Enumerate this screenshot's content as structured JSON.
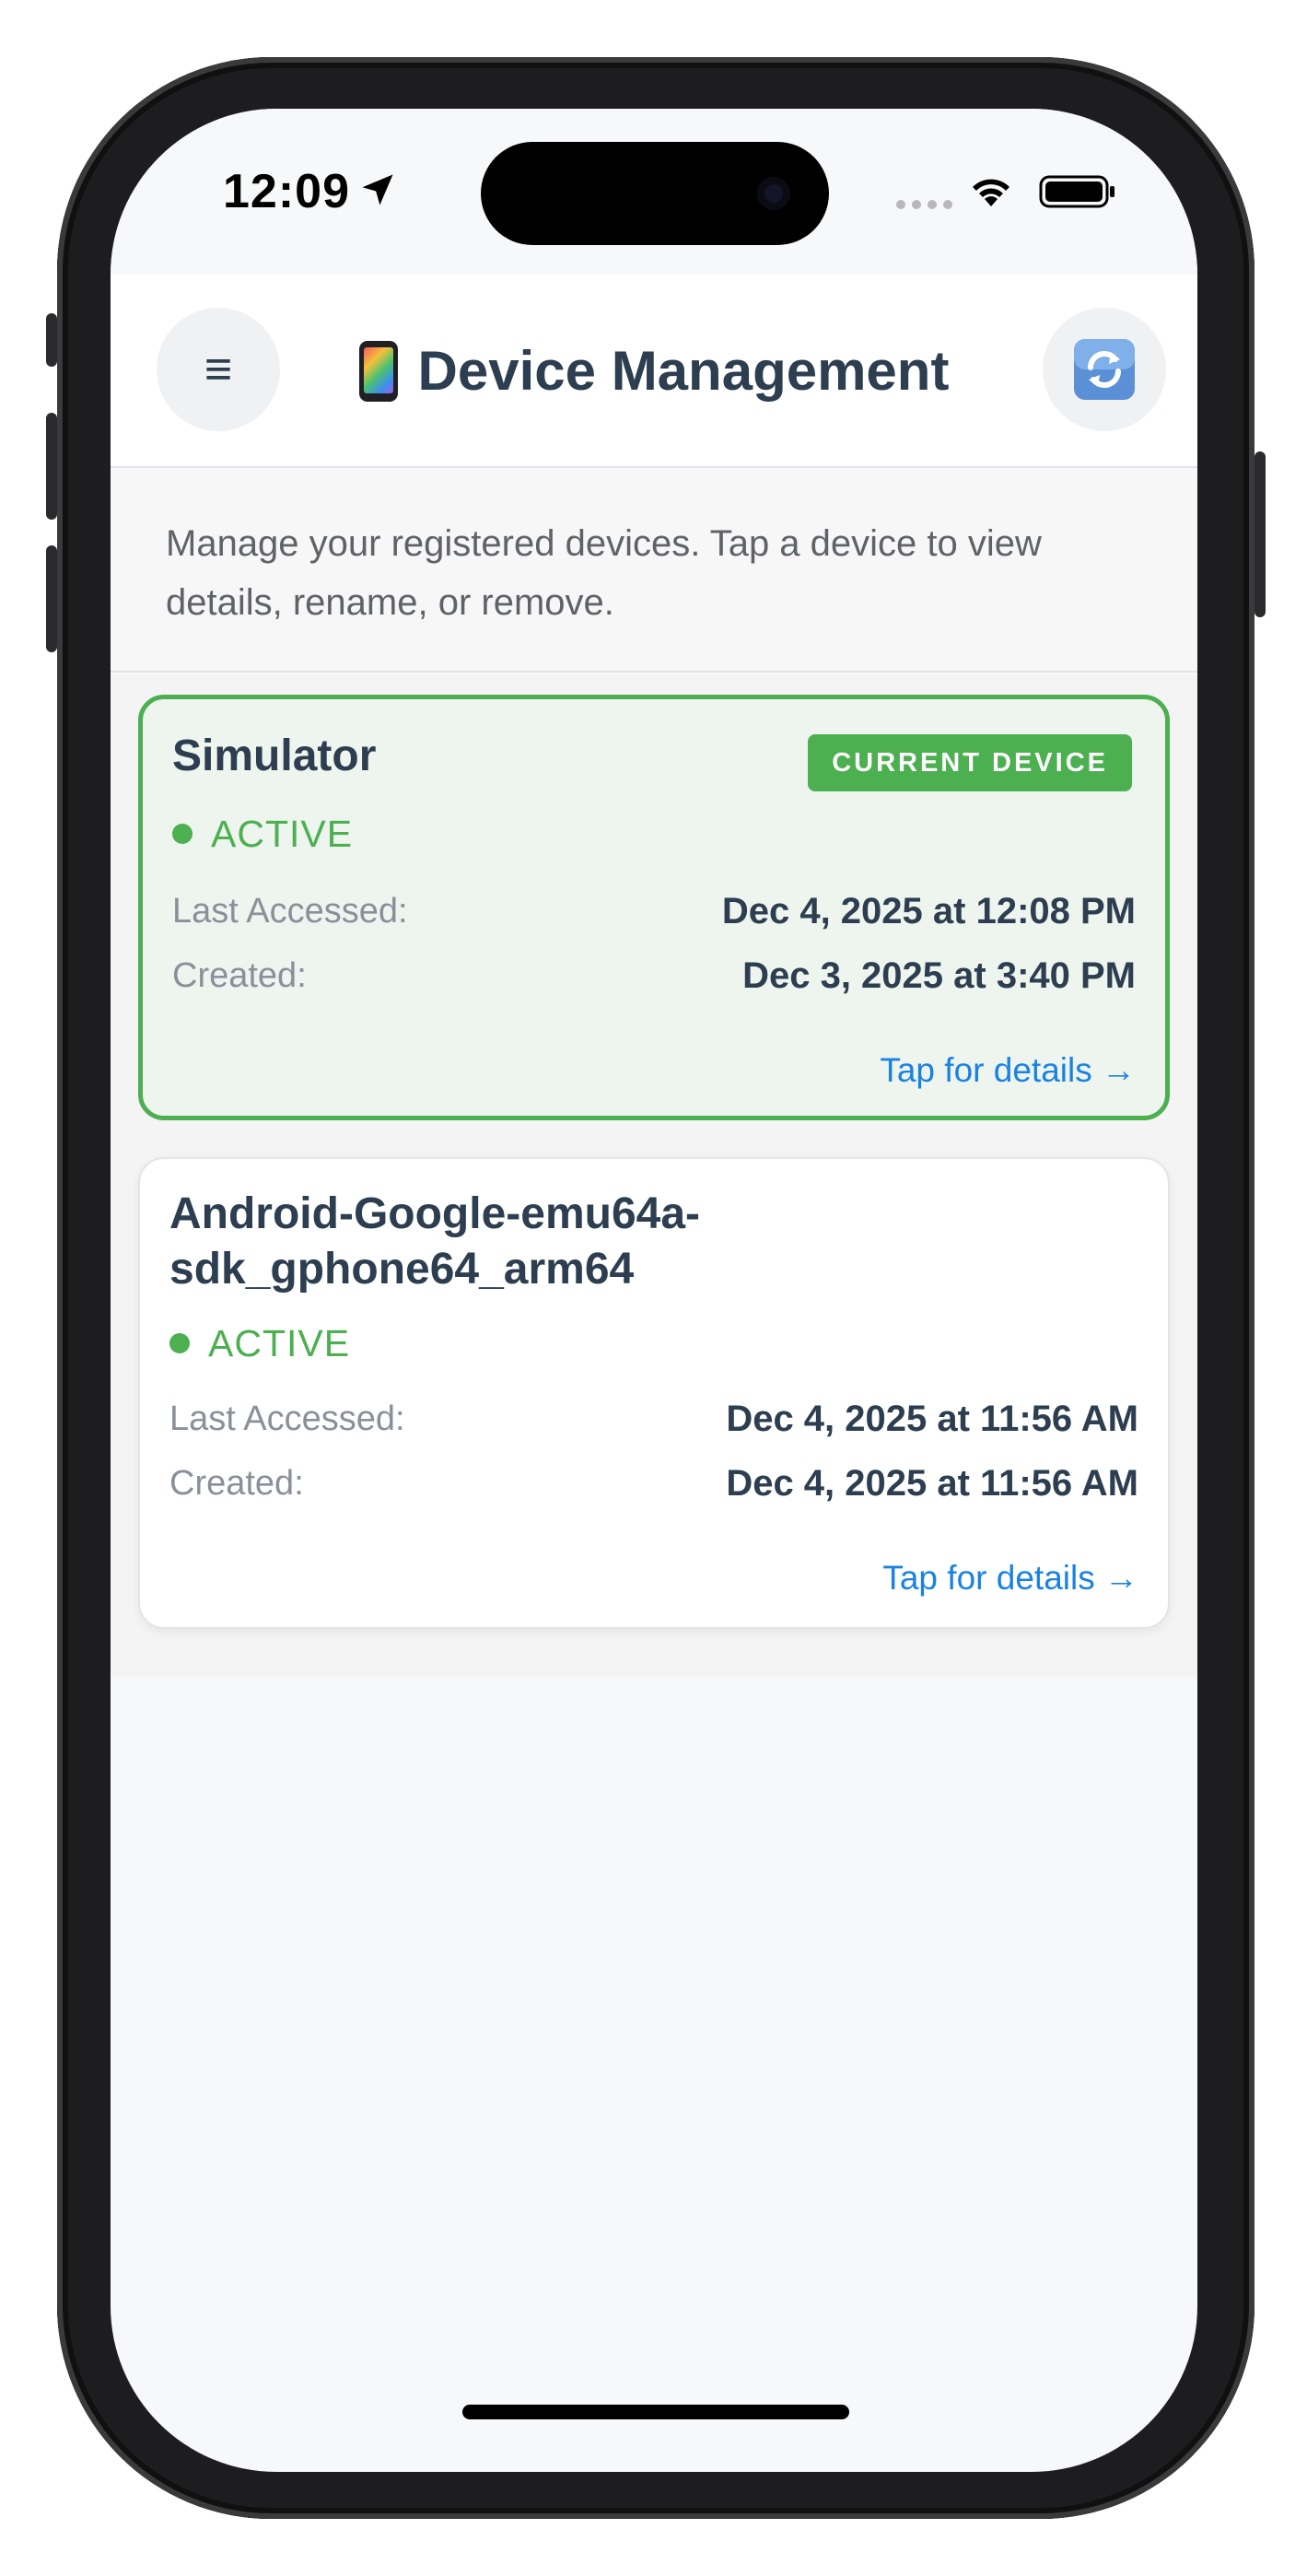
{
  "status_bar": {
    "time": "12:09"
  },
  "header": {
    "title": "Device Management",
    "title_icon": "mobile-phone-icon",
    "menu_icon": "hamburger-menu-icon",
    "refresh_icon": "refresh-icon"
  },
  "description": "Manage your registered devices. Tap a device to view details, rename, or remove.",
  "devices": [
    {
      "name": "Simulator",
      "badge": "CURRENT DEVICE",
      "status": "ACTIVE",
      "last_accessed_label": "Last Accessed:",
      "last_accessed": "Dec 4, 2025 at 12:08 PM",
      "created_label": "Created:",
      "created": "Dec 3, 2025 at 3:40 PM",
      "details_link": "Tap for details →"
    },
    {
      "name": "Android-Google-emu64a-sdk_gphone64_arm64",
      "status": "ACTIVE",
      "last_accessed_label": "Last Accessed:",
      "last_accessed": "Dec 4, 2025 at 11:56 AM",
      "created_label": "Created:",
      "created": "Dec 4, 2025 at 11:56 AM",
      "details_link": "Tap for details →"
    }
  ],
  "colors": {
    "accent_green": "#4caf50",
    "link_blue": "#1a82e2",
    "title_dark": "#2c3e50"
  }
}
